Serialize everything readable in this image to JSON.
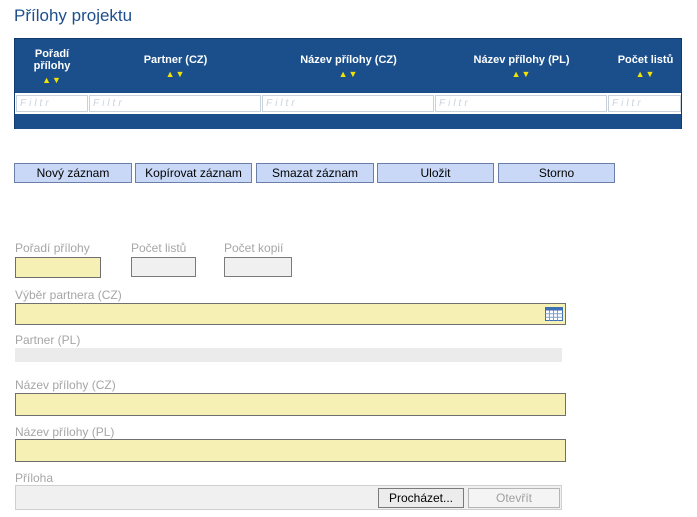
{
  "page": {
    "title": "Přílohy projektu"
  },
  "grid": {
    "columns": [
      {
        "label_line1": "Pořadí",
        "label_line2": "přílohy",
        "sort": "▲▼"
      },
      {
        "label_line1": "Partner (CZ)",
        "label_line2": "",
        "sort": "▲▼"
      },
      {
        "label_line1": "Název přílohy (CZ)",
        "label_line2": "",
        "sort": "▲▼"
      },
      {
        "label_line1": "Název přílohy (PL)",
        "label_line2": "",
        "sort": "▲▼"
      },
      {
        "label_line1": "Počet listů",
        "label_line2": "",
        "sort": "▲▼"
      }
    ],
    "filter_placeholder": "Filtr"
  },
  "toolbar": {
    "new": "Nový záznam",
    "copy": "Kopírovat záznam",
    "delete": "Smazat záznam",
    "save": "Uložit",
    "cancel": "Storno"
  },
  "form": {
    "order_label": "Pořadí přílohy",
    "sheets_label": "Počet listů",
    "copies_label": "Počet kopií",
    "partner_select_label": "Výběr partnera (CZ)",
    "partner_pl_label": "Partner (PL)",
    "name_cz_label": "Název přílohy (CZ)",
    "name_pl_label": "Název přílohy (PL)",
    "attachment_label": "Příloha",
    "browse_button": "Procházet...",
    "open_button": "Otevřít"
  },
  "colors": {
    "header_blue": "#1a4f8c",
    "sort_arrow": "#f2e400",
    "required_field": "#f7f0b5",
    "button_fill": "#c9d8f7"
  }
}
